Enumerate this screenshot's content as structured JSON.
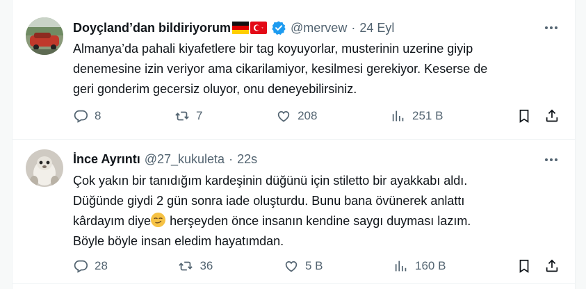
{
  "tweets": [
    {
      "name": "Doyçland’dan bildiriyorum",
      "handle": "@mervew",
      "separator": "·",
      "time": "24 Eyl",
      "lines": [
        "Almanya’da pahali kiyafetlere bir tag koyuyorlar, musterinin uzerine giyip",
        "denemesine izin veriyor ama cikarilamiyor, kesilmesi gerekiyor. Keserse de",
        "geri gonderim gecersiz oluyor, onu deneyebilirsiniz."
      ],
      "replies": "8",
      "reposts": "7",
      "likes": "208",
      "views": "251 B",
      "icons": {
        "verified": "verified-badge-icon",
        "flags": [
          "germany-flag-icon",
          "turkey-flag-icon"
        ]
      }
    },
    {
      "name": "İnce Ayrıntı",
      "handle": "@27_kukuleta",
      "separator": "·",
      "time": "22s",
      "lines": [
        "Çok yakın bir tanıdığım kardeşinin düğünü için stiletto bir ayakkabı aldı.",
        "Düğünde giydi 2 gün sonra iade oluşturdu. Bunu bana övünerek anlattı",
        "kâr",
        "dayım diye",
        " herşeyden önce insanın kendine saygı duyması lazım.",
        "Böyle böyle insan eledim hayatımdan."
      ],
      "replies": "28",
      "reposts": "36",
      "likes": "5 B",
      "views": "160 B",
      "icons": {
        "emoji": "smirking-face-emoji"
      }
    }
  ],
  "colors": {
    "text": "#0f1419",
    "secondary": "#536471",
    "verified": "#1d9bf0",
    "border": "#eff3f4"
  }
}
